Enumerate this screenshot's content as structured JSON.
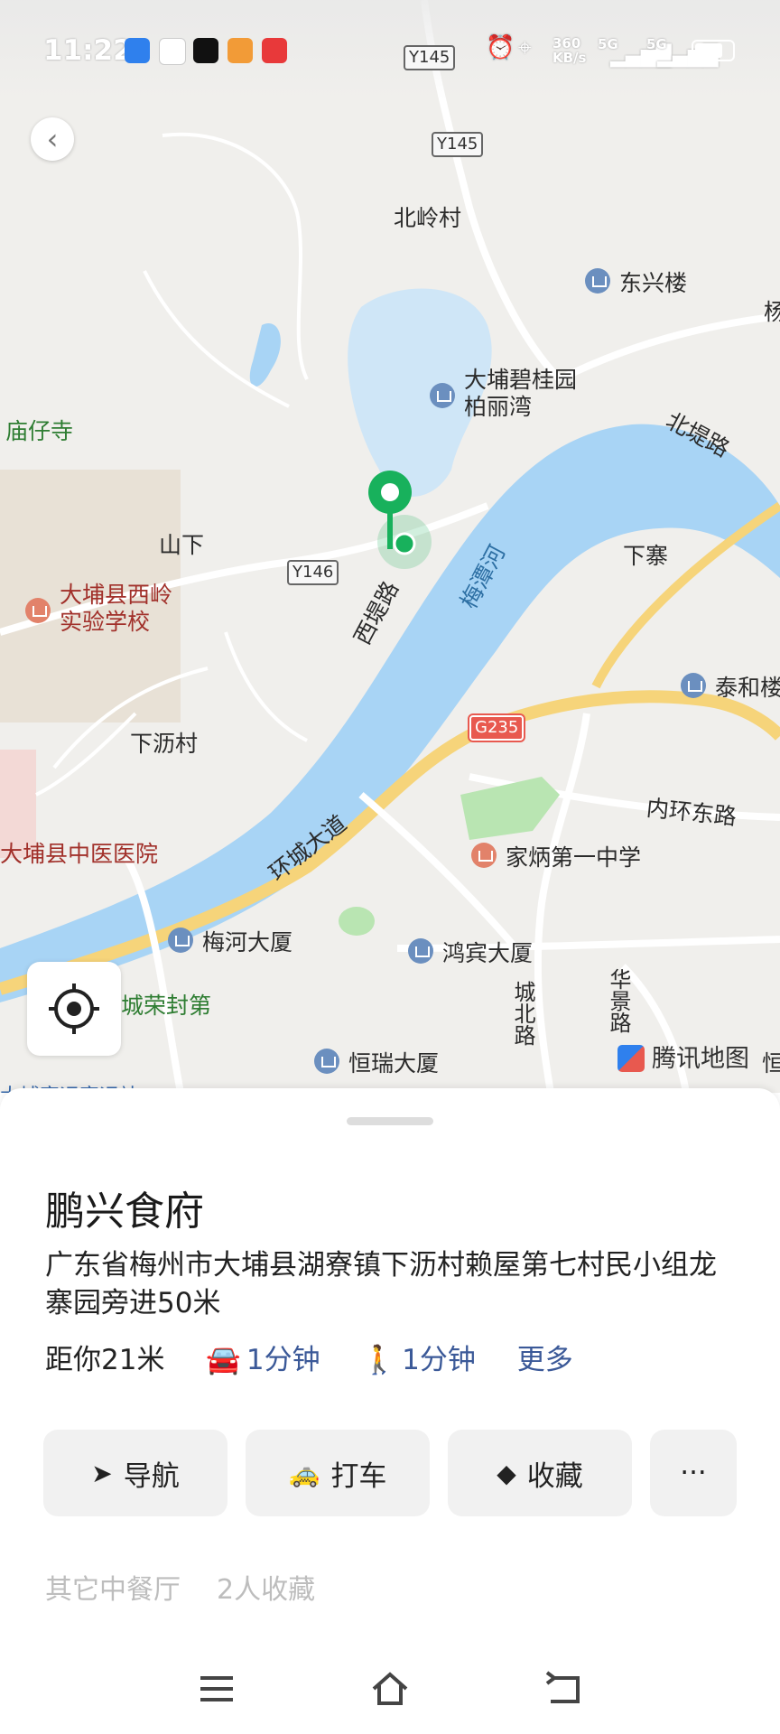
{
  "status_bar": {
    "time": "11:22",
    "net_speed": "360\nKB/s",
    "signal1": "5G",
    "signal2": "5G",
    "badge_road": "Y145"
  },
  "map": {
    "labels": {
      "y145": "Y145",
      "beiling": "北岭村",
      "dongxing": "东兴楼",
      "yang": "杨",
      "biguiyuan": "大埔碧桂园\n柏丽湾",
      "beidi": "北堤路",
      "miaozaisi": "庙仔寺",
      "shanxia": "山下",
      "y146": "Y146",
      "xidi": "西堤路",
      "meitanhe": "梅潭河",
      "xiazhai": "下寨",
      "xiling_school": "大埔县西岭\n实验学校",
      "taihe": "泰和楼",
      "xialicun": "下沥村",
      "g235": "G235",
      "neihuan": "内环东路",
      "hospital": "大埔县中医医院",
      "huancheng": "环城大道",
      "jiabing": "家炳第一中学",
      "meihe": "梅河大厦",
      "hongbin": "鸿宾大厦",
      "chengbei": "城北路",
      "huajing": "华景路",
      "chengrong": "城荣封第",
      "hengrui": "恒瑞大厦",
      "heng2": "恒",
      "station": "大埔客运客运站"
    },
    "brand": "腾讯地图",
    "colors": {
      "water": "#a8d4f5",
      "highway": "#f6d47a",
      "marker": "#18b15c"
    }
  },
  "place": {
    "name": "鹏兴食府",
    "address": "广东省梅州市大埔县湖寮镇下沥村赖屋第七村民小组龙寨园旁进50米",
    "distance": "距你21米",
    "drive": "1分钟",
    "walk": "1分钟",
    "more": "更多",
    "actions": {
      "navigate": "导航",
      "taxi": "打车",
      "favorite": "收藏",
      "more": "···"
    },
    "category": "其它中餐厅",
    "favorites": "2人收藏"
  },
  "icons": {
    "back": "chevron-left-icon",
    "locate": "locate-icon",
    "car": "car-icon",
    "walk": "walk-icon",
    "navigate": "navigation-arrow-icon",
    "taxi": "taxi-icon",
    "favorite": "cube-icon",
    "menu": "menu-icon",
    "home": "home-icon",
    "back_nav": "back-icon"
  }
}
